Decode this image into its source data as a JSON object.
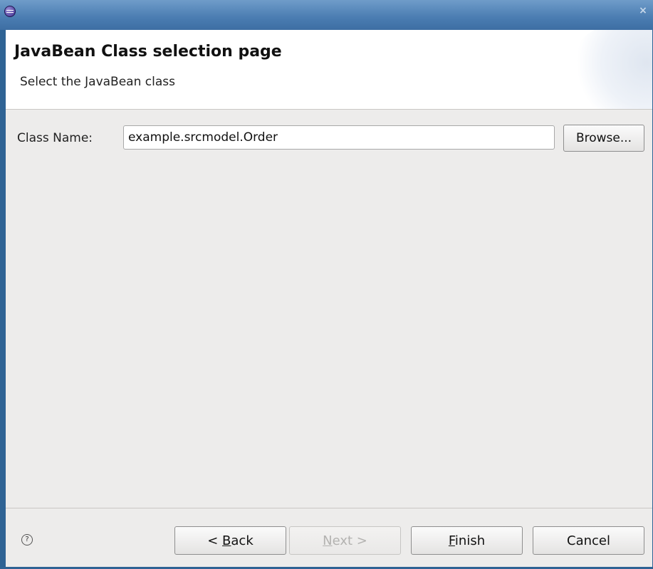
{
  "header": {
    "title": "JavaBean Class selection page",
    "subtitle": "Select the JavaBean class"
  },
  "form": {
    "class_name_label": "Class Name:",
    "class_name_value": "example.srcmodel.Order",
    "browse_label": "Browse..."
  },
  "footer": {
    "help_glyph": "?",
    "back": {
      "prefix": "< ",
      "mnemonic": "B",
      "rest": "ack"
    },
    "next": {
      "mnemonic": "N",
      "rest": "ext >",
      "enabled": false
    },
    "finish": {
      "mnemonic": "F",
      "rest": "inish"
    },
    "cancel_label": "Cancel"
  },
  "titlebar": {
    "close_glyph": "×"
  },
  "icons": [
    "eclipse-app-icon",
    "close-icon",
    "help-icon"
  ],
  "colors": {
    "titlebar": "#4a7cb1",
    "dialog_bg": "#edeceb",
    "header_bg": "#ffffff"
  }
}
